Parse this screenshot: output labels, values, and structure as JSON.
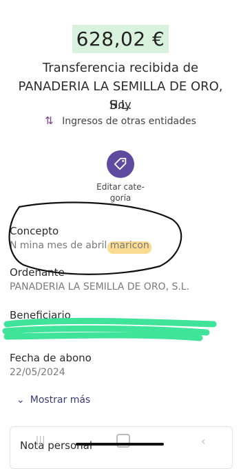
{
  "transaction": {
    "amount": "628,02 €",
    "title": "Transferencia recibida de PANADERIA LA SEMILLA DE ORO, S.L.",
    "date_label": "Hoy",
    "category": "Ingresos de otras entidades"
  },
  "actions": {
    "edit_category_label": "Editar cate-\ngoría",
    "show_more_label": "Mostrar más"
  },
  "fields": {
    "concepto": {
      "label": "Concepto",
      "value": "N mina mes de abril maricon"
    },
    "ordenante": {
      "label": "Ordenante",
      "value": "PANADERIA LA SEMILLA DE ORO, S.L."
    },
    "beneficiario": {
      "label": "Beneficiario",
      "value": ""
    },
    "fecha_abono": {
      "label": "Fecha de abono",
      "value": "22/05/2024"
    }
  },
  "note": {
    "label": "Nota personal"
  },
  "colors": {
    "amount_highlight": "#d9f2dd",
    "accent_purple": "#5e4a9f",
    "scribble_green": "#3fe39a",
    "highlight_yellow": "#f6c64a"
  }
}
